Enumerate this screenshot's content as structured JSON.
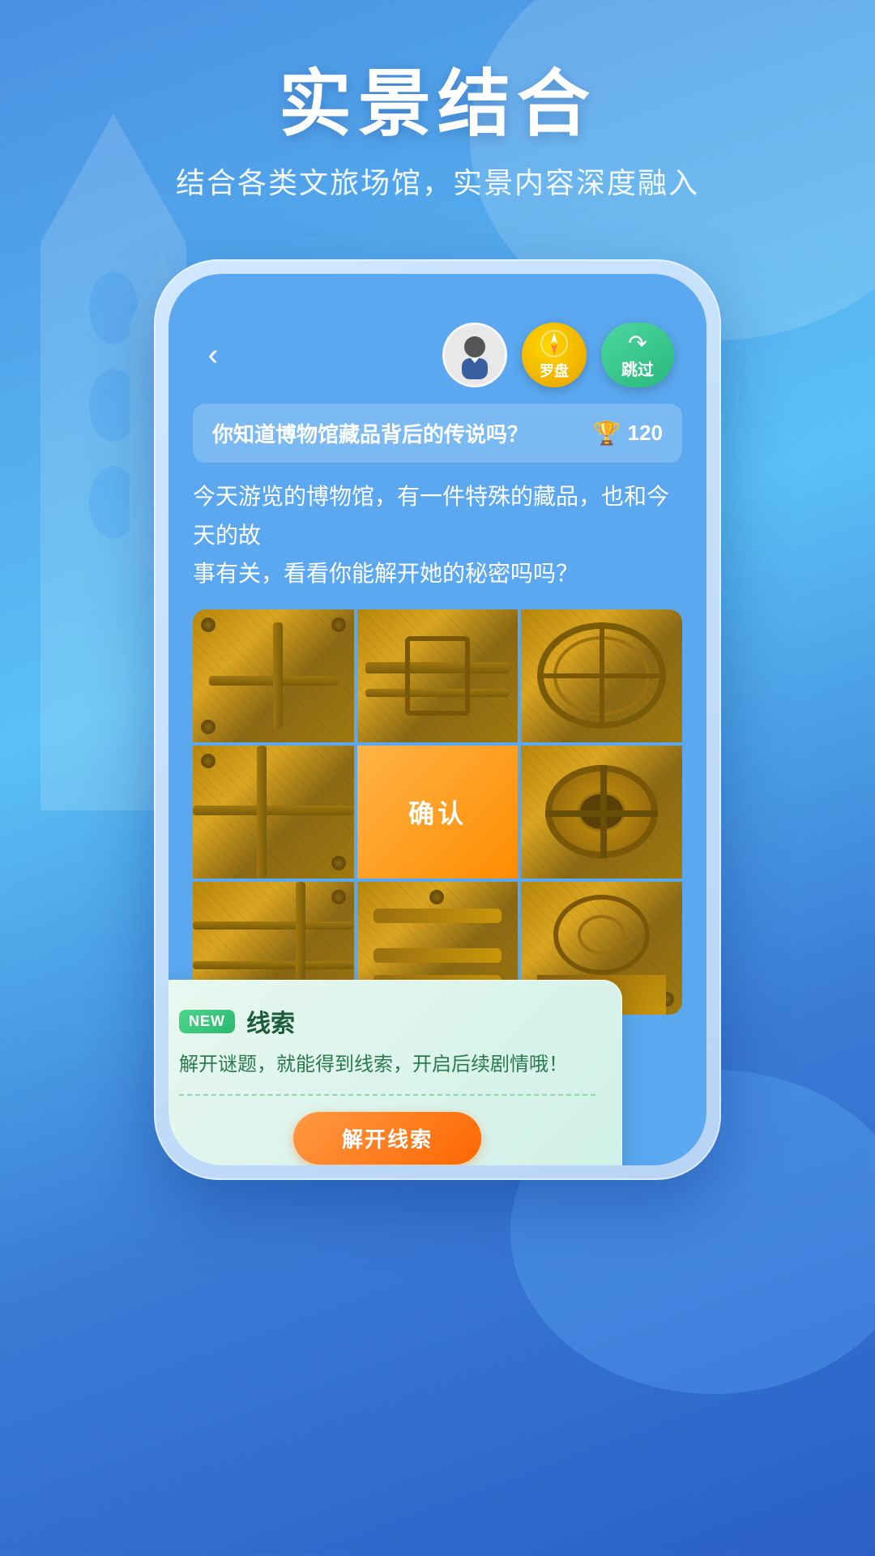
{
  "page": {
    "background": {
      "gradient_start": "#4a90e2",
      "gradient_end": "#2a5fc8"
    }
  },
  "header": {
    "main_title": "实景结合",
    "sub_title": "结合各类文旅场馆，实景内容深度融入"
  },
  "phone": {
    "back_label": "‹",
    "compass_label": "罗盘",
    "skip_label": "跳过",
    "skip_arrow": "↪"
  },
  "question": {
    "text": "你知道博物馆藏品背后的传说吗？",
    "score": "120",
    "score_icon": "🏆"
  },
  "description": {
    "text": "今天游览的博物馆，有一件特殊的藏品，也和今天的故\n事有关，看看你能解开她的秘密吗吗？"
  },
  "puzzle": {
    "confirm_label": "确认",
    "grid_size": 3
  },
  "clue_card": {
    "new_badge": "NEW",
    "title": "线索",
    "description": "解开谜题，就能得到线索，开启后续剧情哦！",
    "unlock_button": "解开线索"
  },
  "avatar": {
    "type": "person-silhouette"
  },
  "icons": {
    "back": "chevron-left",
    "compass": "compass",
    "skip": "forward-arrow",
    "trophy": "trophy"
  }
}
